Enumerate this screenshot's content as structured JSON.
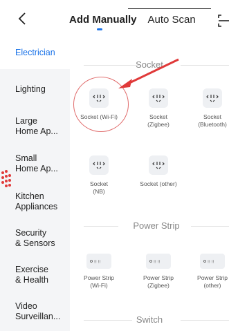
{
  "header": {
    "tabs": [
      {
        "label": "Add Manually",
        "active": true
      },
      {
        "label": "Auto Scan",
        "active": false
      }
    ]
  },
  "sidebar": {
    "items": [
      {
        "label": "Electrician",
        "active": true
      },
      {
        "label": "Lighting"
      },
      {
        "label": "Large\nHome Ap..."
      },
      {
        "label": "Small\nHome Ap..."
      },
      {
        "label": "Kitchen\nAppliances"
      },
      {
        "label": "Security\n& Sensors"
      },
      {
        "label": "Exercise\n& Health"
      },
      {
        "label": "Video\nSurveillan..."
      }
    ]
  },
  "content": {
    "sections": [
      {
        "title": "Socket",
        "items": [
          {
            "label": "Socket (Wi-Fi)",
            "highlighted": true
          },
          {
            "label": "Socket\n(Zigbee)"
          },
          {
            "label": "Socket\n(Bluetooth)"
          },
          {
            "label": "Socket\n(NB)"
          },
          {
            "label": "Socket (other)"
          }
        ]
      },
      {
        "title": "Power Strip",
        "items": [
          {
            "label": "Power Strip\n(Wi-Fi)"
          },
          {
            "label": "Power Strip\n(Zigbee)"
          },
          {
            "label": "Power Strip\n(other)"
          }
        ]
      },
      {
        "title": "Switch",
        "items": []
      }
    ]
  },
  "colors": {
    "accent": "#1a73e8",
    "sidebar_bg": "#f4f5f7",
    "highlight": "#e03a3a"
  }
}
